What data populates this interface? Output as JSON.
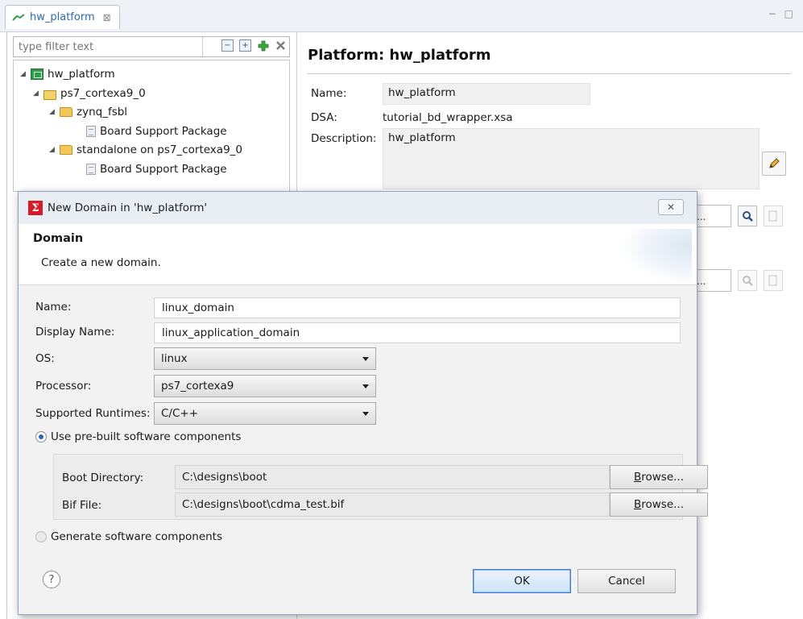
{
  "editor_tab": {
    "title": "hw_platform",
    "close_glyph": "⊠"
  },
  "window_controls": {
    "minimize": "−",
    "maximize": "□"
  },
  "filter": {
    "placeholder": "type filter text",
    "icons": [
      "collapse-all-icon",
      "expand-all-icon",
      "add-icon",
      "remove-icon"
    ]
  },
  "tree": {
    "items": [
      {
        "label": "hw_platform",
        "icon": "platform-icon",
        "level": 0,
        "expanded": true
      },
      {
        "label": "ps7_cortexa9_0",
        "icon": "processor-icon",
        "level": 1,
        "expanded": true
      },
      {
        "label": "zynq_fsbl",
        "icon": "folder-icon",
        "level": 2,
        "expanded": true
      },
      {
        "label": "Board Support Package",
        "icon": "bsp-icon",
        "level": 3
      },
      {
        "label": "standalone on ps7_cortexa9_0",
        "icon": "folder-icon",
        "level": 2,
        "expanded": true
      },
      {
        "label": "Board Support Package",
        "icon": "bsp-icon",
        "level": 3
      }
    ]
  },
  "platform": {
    "title": "Platform: hw_platform",
    "name_label": "Name:",
    "name_value": "hw_platform",
    "dsa_label": "DSA:",
    "dsa_value": "tutorial_bd_wrapper.xsa",
    "description_label": "Description:",
    "description_value": "hw_platform",
    "field_stub": "..."
  },
  "dialog": {
    "title": "New Domain in 'hw_platform'",
    "close_glyph": "✕",
    "header_title": "Domain",
    "header_desc": "Create a new domain.",
    "name_label": "Name:",
    "name_value": "linux_domain",
    "display_name_label": "Display Name:",
    "display_name_value": "linux_application_domain",
    "os_label": "OS:",
    "os_value": "linux",
    "processor_label": "Processor:",
    "processor_value": "ps7_cortexa9",
    "runtimes_label": "Supported Runtimes:",
    "runtimes_value": "C/C++",
    "prebuilt_label": "Use pre-built software components",
    "prebuilt_selected": true,
    "boot_dir_label": "Boot Directory:",
    "boot_dir_value": "C:\\designs\\boot",
    "bif_label": "Bif File:",
    "bif_value": "C:\\designs\\boot\\cdma_test.bif",
    "browse_label_underlined": "B",
    "browse_label_rest": "rowse...",
    "generate_label": "Generate software components",
    "generate_selected": false,
    "help_glyph": "?",
    "ok_label": "OK",
    "cancel_label": "Cancel"
  }
}
